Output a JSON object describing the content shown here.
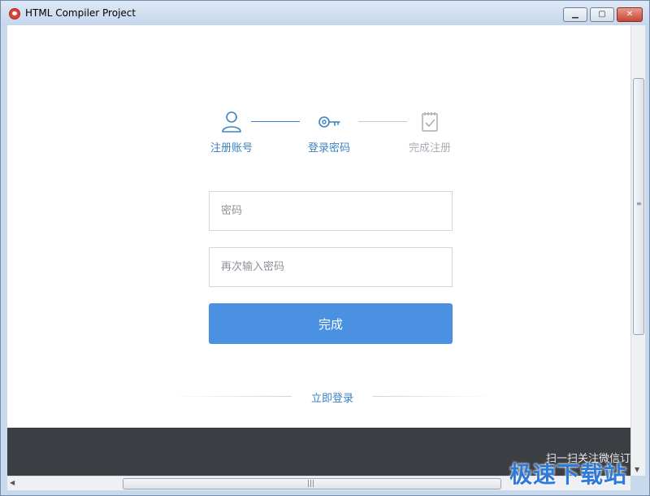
{
  "window": {
    "title": "HTML Compiler Project",
    "controls": {
      "minimize": "▁",
      "maximize": "▢",
      "close": "✕"
    }
  },
  "steps": [
    {
      "label": "注册账号",
      "icon": "user-icon",
      "state": "done"
    },
    {
      "label": "登录密码",
      "icon": "key-icon",
      "state": "active"
    },
    {
      "label": "完成注册",
      "icon": "checklist-icon",
      "state": "pending"
    }
  ],
  "form": {
    "password_placeholder": "密码",
    "password_value": "",
    "confirm_placeholder": "再次输入密码",
    "confirm_value": "",
    "submit_label": "完成"
  },
  "login_link": "立即登录",
  "footer": {
    "text": "扫一扫关注微信订"
  },
  "watermark": "极速下载站",
  "colors": {
    "accent": "#3c82c4",
    "button": "#4a91e2",
    "footer_bg": "#3b3e42",
    "inactive": "#a8aeb5"
  }
}
